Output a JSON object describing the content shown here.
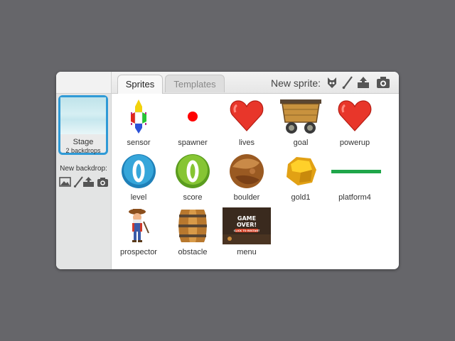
{
  "tabs": {
    "sprites": "Sprites",
    "templates": "Templates"
  },
  "new_sprite_label": "New sprite:",
  "new_sprite_tools": [
    "sprite-library-icon",
    "paint-brush-icon",
    "upload-icon",
    "camera-icon"
  ],
  "stage": {
    "label": "Stage",
    "sub": "2 backdrops"
  },
  "new_backdrop_label": "New backdrop:",
  "new_backdrop_tools": [
    "image-icon",
    "paint-brush-icon",
    "upload-icon",
    "camera-icon"
  ],
  "sprites": [
    {
      "name": "sensor",
      "icon": "sensor-icon"
    },
    {
      "name": "spawner",
      "icon": "red-dot-icon"
    },
    {
      "name": "lives",
      "icon": "heart-icon"
    },
    {
      "name": "goal",
      "icon": "mine-cart-icon"
    },
    {
      "name": "powerup",
      "icon": "heart-icon"
    },
    {
      "name": "level",
      "icon": "blue-zero-icon"
    },
    {
      "name": "score",
      "icon": "green-zero-icon"
    },
    {
      "name": "boulder",
      "icon": "boulder-icon"
    },
    {
      "name": "gold1",
      "icon": "gold-nugget-icon"
    },
    {
      "name": "platform4",
      "icon": "green-bar-icon"
    },
    {
      "name": "prospector",
      "icon": "prospector-icon"
    },
    {
      "name": "obstacle",
      "icon": "barrel-icon"
    },
    {
      "name": "menu",
      "icon": "game-over-screen-icon"
    }
  ],
  "menu_thumb_text": {
    "line1": "GAME",
    "line2": "OVER!",
    "line3": "CLICK TO RESTART"
  },
  "colors": {
    "selection": "#2f9ad6",
    "tab_active": "#f8f8f8",
    "background": "#66666a"
  }
}
